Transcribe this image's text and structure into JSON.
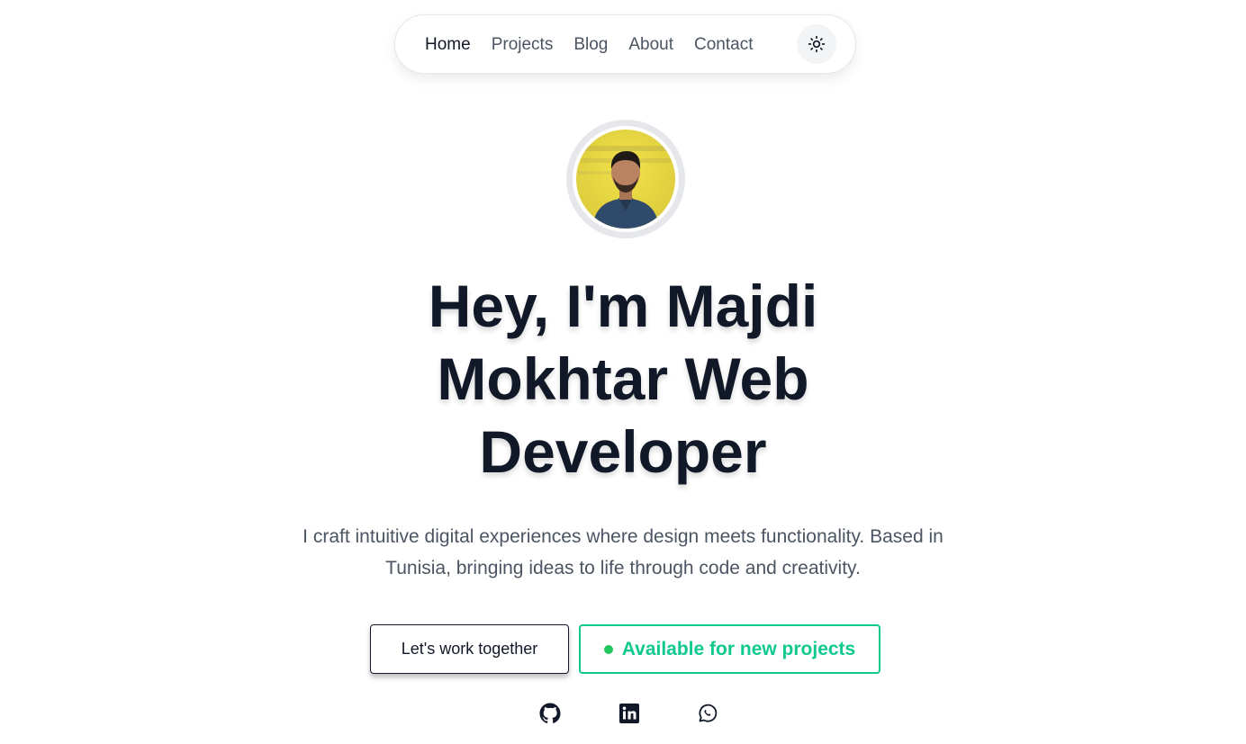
{
  "nav": {
    "links": [
      {
        "label": "Home",
        "active": true
      },
      {
        "label": "Projects",
        "active": false
      },
      {
        "label": "Blog",
        "active": false
      },
      {
        "label": "About",
        "active": false
      },
      {
        "label": "Contact",
        "active": false
      }
    ],
    "theme_toggle_icon": "sun-icon"
  },
  "hero": {
    "avatar_alt": "avatar-photo",
    "headline_lines": [
      "Hey, I'm Majdi",
      "Mokhtar Web",
      "Developer"
    ],
    "subtitle": "I craft intuitive digital experiences where design meets functionality. Based in Tunisia, bringing ideas to life through code and creativity.",
    "cta_primary": "Let's work together",
    "cta_status": "Available for new projects"
  },
  "socials": [
    "github-icon",
    "linkedin-icon",
    "whatsapp-icon"
  ],
  "colors": {
    "text_dark": "#111827",
    "text_muted": "#4b5563",
    "accent_green": "#10c98f",
    "status_dot": "#22c55e"
  }
}
